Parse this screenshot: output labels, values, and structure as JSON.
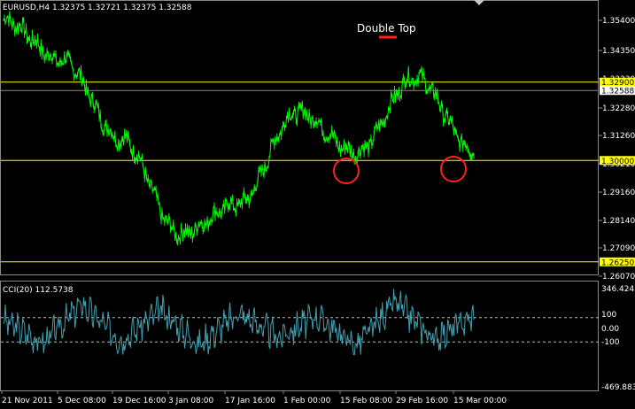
{
  "window_info": "EURUSD,H4  1.32375 1.32721 1.32375 1.32588",
  "indicator_info": "CCI(20) 112.5738",
  "annotation": "Double Top",
  "price_axis": {
    "tick_labels": [
      "1.35400",
      "1.34350",
      "1.33330",
      "1.32280",
      "1.31260",
      "1.30210",
      "1.29160",
      "1.28140",
      "1.27090",
      "1.26070"
    ],
    "highlighted_levels": [
      {
        "label": "1.32900",
        "value": 1.329,
        "color": "#ffff00"
      },
      {
        "label": "1.30000",
        "value": 1.3,
        "color": "#ffff00"
      },
      {
        "label": "1.26250",
        "value": 1.2625,
        "color": "#ffff00"
      }
    ],
    "current_price": {
      "label": "1.32588",
      "value": 1.32588
    }
  },
  "indicator_axis": {
    "tick_labels": [
      "346.4245",
      "100",
      "0.00",
      "-100",
      "-469.8830"
    ],
    "levels": [
      100,
      -100
    ]
  },
  "time_axis": {
    "tick_labels": [
      "21 Nov 2011",
      "5 Dec 08:00",
      "19 Dec 16:00",
      "3 Jan 08:00",
      "17 Jan 16:00",
      "1 Feb 00:00",
      "15 Feb 08:00",
      "29 Feb 16:00",
      "15 Mar 00:00"
    ]
  },
  "chart_data": {
    "type": "line",
    "title": "EURUSD,H4",
    "series": [
      {
        "name": "EURUSD",
        "color": "#00ff00",
        "x": [
          "21 Nov 2011",
          "5 Dec 08:00",
          "19 Dec 16:00",
          "3 Jan 08:00",
          "17 Jan 16:00",
          "1 Feb 00:00",
          "15 Feb 08:00",
          "29 Feb 16:00",
          "15 Mar 00:00"
        ],
        "values": [
          1.352,
          1.337,
          1.308,
          1.273,
          1.284,
          1.318,
          1.303,
          1.331,
          1.304
        ]
      },
      {
        "name": "CCI(20)",
        "color": "#3fa0b0",
        "values": [
          80,
          -110,
          210,
          -90,
          160,
          -120,
          140,
          -60,
          110,
          -130,
          230,
          -80,
          112.5738
        ]
      }
    ],
    "ylim": [
      1.2585,
      1.3587
    ],
    "indicator_ylim": [
      -469.883,
      346.4245
    ]
  }
}
